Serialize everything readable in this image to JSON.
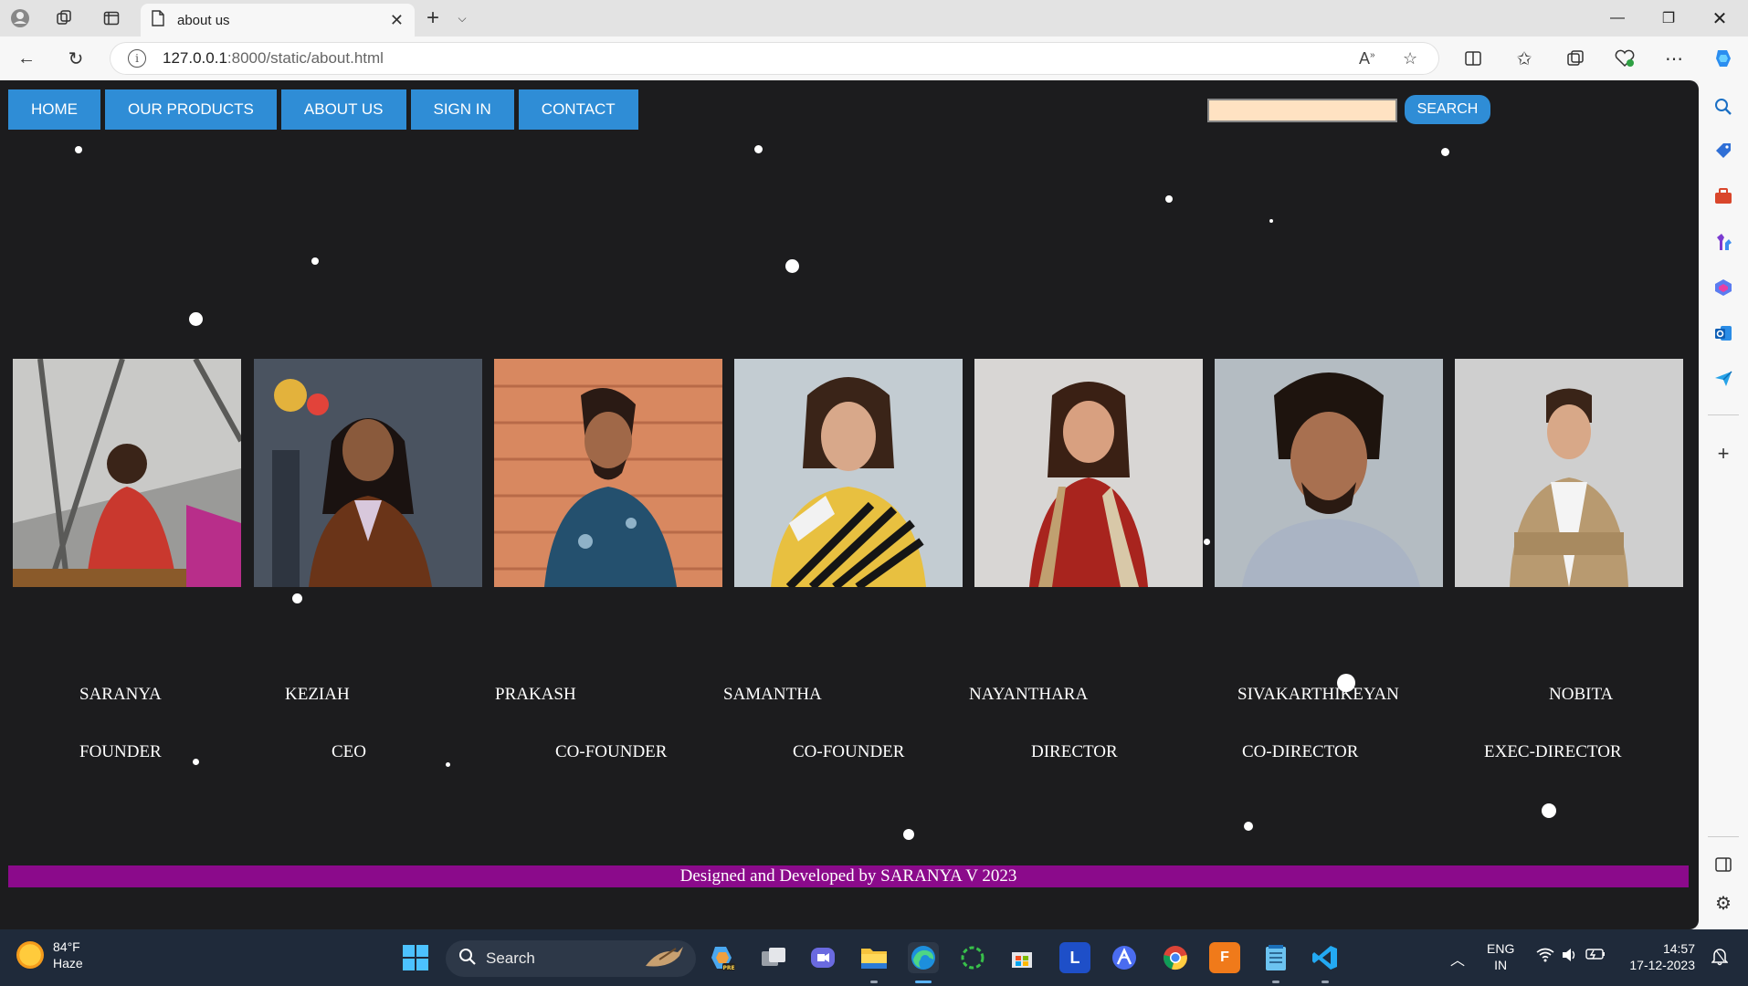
{
  "browser": {
    "tab_title": "about us",
    "url_host": "127.0.0.1",
    "url_path": ":8000/static/about.html"
  },
  "site": {
    "nav": [
      "HOME",
      "OUR PRODUCTS",
      "ABOUT US",
      "SIGN IN",
      "CONTACT"
    ],
    "search_placeholder": "",
    "search_button": "SEARCH",
    "team": [
      {
        "name": "SARANYA",
        "role": "FOUNDER"
      },
      {
        "name": "KEZIAH",
        "role": "CEO"
      },
      {
        "name": "PRAKASH",
        "role": "CO-FOUNDER"
      },
      {
        "name": "SAMANTHA",
        "role": "CO-FOUNDER"
      },
      {
        "name": "NAYANTHARA",
        "role": "DIRECTOR"
      },
      {
        "name": "SIVAKARTHIKEYAN",
        "role": "CO-DIRECTOR"
      },
      {
        "name": "NOBITA",
        "role": "EXEC-DIRECTOR"
      }
    ],
    "footer": "Designed and Developed by SARANYA V 2023"
  },
  "taskbar": {
    "weather_temp": "84°F",
    "weather_desc": "Haze",
    "search_label": "Search",
    "lang_line1": "ENG",
    "lang_line2": "IN",
    "time": "14:57",
    "date": "17-12-2023"
  },
  "colors": {
    "page_bg": "#1c1c1e",
    "nav_button": "#2f8dd6",
    "footer_bg": "#8b0a8b",
    "search_input_bg": "#ffe2c2"
  }
}
